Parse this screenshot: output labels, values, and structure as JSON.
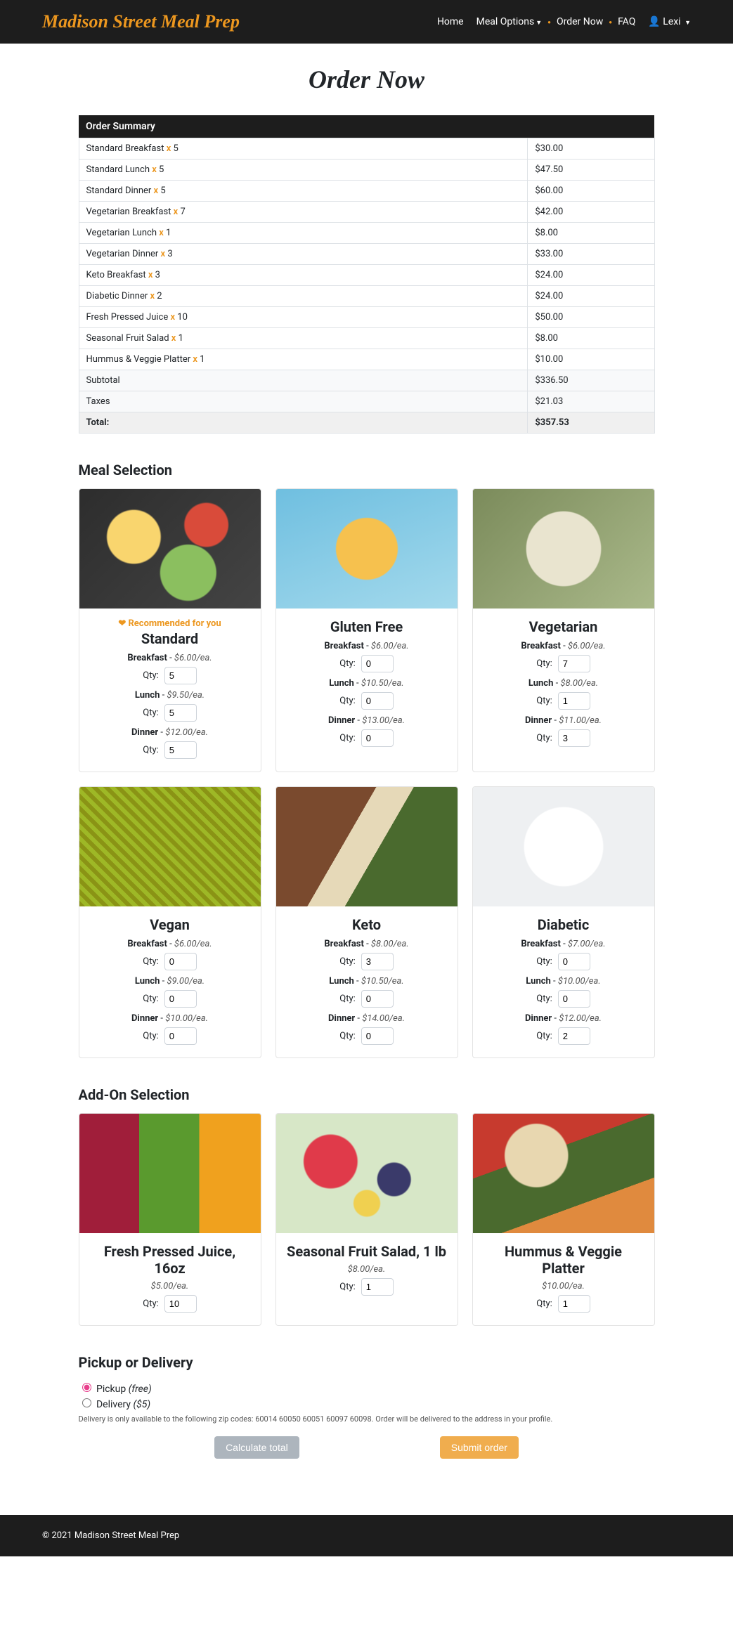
{
  "brand": "Madison Street Meal Prep",
  "nav": {
    "home": "Home",
    "meal_options": "Meal Options",
    "order_now": "Order Now",
    "faq": "FAQ",
    "user": "Lexi"
  },
  "page_title": "Order Now",
  "summary": {
    "header": "Order Summary",
    "rows": [
      {
        "name": "Standard Breakfast",
        "qty": "5",
        "price": "$30.00"
      },
      {
        "name": "Standard Lunch",
        "qty": "5",
        "price": "$47.50"
      },
      {
        "name": "Standard Dinner",
        "qty": "5",
        "price": "$60.00"
      },
      {
        "name": "Vegetarian Breakfast",
        "qty": "7",
        "price": "$42.00"
      },
      {
        "name": "Vegetarian Lunch",
        "qty": "1",
        "price": "$8.00"
      },
      {
        "name": "Vegetarian Dinner",
        "qty": "3",
        "price": "$33.00"
      },
      {
        "name": "Keto Breakfast",
        "qty": "3",
        "price": "$24.00"
      },
      {
        "name": "Diabetic Dinner",
        "qty": "2",
        "price": "$24.00"
      },
      {
        "name": "Fresh Pressed Juice",
        "qty": "10",
        "price": "$50.00"
      },
      {
        "name": "Seasonal Fruit Salad",
        "qty": "1",
        "price": "$8.00"
      },
      {
        "name": "Hummus & Veggie Platter",
        "qty": "1",
        "price": "$10.00"
      }
    ],
    "subtotal_label": "Subtotal",
    "subtotal": "$336.50",
    "taxes_label": "Taxes",
    "taxes": "$21.03",
    "total_label": "Total:",
    "total": "$357.53"
  },
  "meal_section_title": "Meal Selection",
  "recommended_label": "Recommended for you",
  "qty_label": "Qty:",
  "meal_labels": {
    "breakfast": "Breakfast",
    "lunch": "Lunch",
    "dinner": "Dinner"
  },
  "meals": [
    {
      "title": "Standard",
      "recommended": true,
      "img": "img-standard",
      "breakfast": {
        "price": "$6.00/ea.",
        "qty": "5"
      },
      "lunch": {
        "price": "$9.50/ea.",
        "qty": "5"
      },
      "dinner": {
        "price": "$12.00/ea.",
        "qty": "5"
      }
    },
    {
      "title": "Gluten Free",
      "img": "img-gf",
      "breakfast": {
        "price": "$6.00/ea.",
        "qty": "0"
      },
      "lunch": {
        "price": "$10.50/ea.",
        "qty": "0"
      },
      "dinner": {
        "price": "$13.00/ea.",
        "qty": "0"
      }
    },
    {
      "title": "Vegetarian",
      "img": "img-veg",
      "breakfast": {
        "price": "$6.00/ea.",
        "qty": "7"
      },
      "lunch": {
        "price": "$8.00/ea.",
        "qty": "1"
      },
      "dinner": {
        "price": "$11.00/ea.",
        "qty": "3"
      }
    },
    {
      "title": "Vegan",
      "img": "img-vegan",
      "breakfast": {
        "price": "$6.00/ea.",
        "qty": "0"
      },
      "lunch": {
        "price": "$9.00/ea.",
        "qty": "0"
      },
      "dinner": {
        "price": "$10.00/ea.",
        "qty": "0"
      }
    },
    {
      "title": "Keto",
      "img": "img-keto",
      "breakfast": {
        "price": "$8.00/ea.",
        "qty": "3"
      },
      "lunch": {
        "price": "$10.50/ea.",
        "qty": "0"
      },
      "dinner": {
        "price": "$14.00/ea.",
        "qty": "0"
      }
    },
    {
      "title": "Diabetic",
      "img": "img-diabetic",
      "breakfast": {
        "price": "$7.00/ea.",
        "qty": "0"
      },
      "lunch": {
        "price": "$10.00/ea.",
        "qty": "0"
      },
      "dinner": {
        "price": "$12.00/ea.",
        "qty": "2"
      }
    }
  ],
  "addon_section_title": "Add-On Selection",
  "addons": [
    {
      "title": "Fresh Pressed Juice, 16oz",
      "img": "img-juice",
      "price": "$5.00/ea.",
      "qty": "10"
    },
    {
      "title": "Seasonal Fruit Salad, 1 lb",
      "img": "img-fruit",
      "price": "$8.00/ea.",
      "qty": "1"
    },
    {
      "title": "Hummus & Veggie Platter",
      "img": "img-hummus",
      "price": "$10.00/ea.",
      "qty": "1"
    }
  ],
  "pd": {
    "title": "Pickup or Delivery",
    "pickup_label": "Pickup",
    "pickup_note": "(free)",
    "delivery_label": "Delivery",
    "delivery_note": "($5)",
    "info": "Delivery is only available to the following zip codes: 60014 60050 60051 60097 60098. Order will be delivered to the address in your profile."
  },
  "buttons": {
    "calc": "Calculate total",
    "submit": "Submit order"
  },
  "footer": "© 2021 Madison Street Meal Prep"
}
